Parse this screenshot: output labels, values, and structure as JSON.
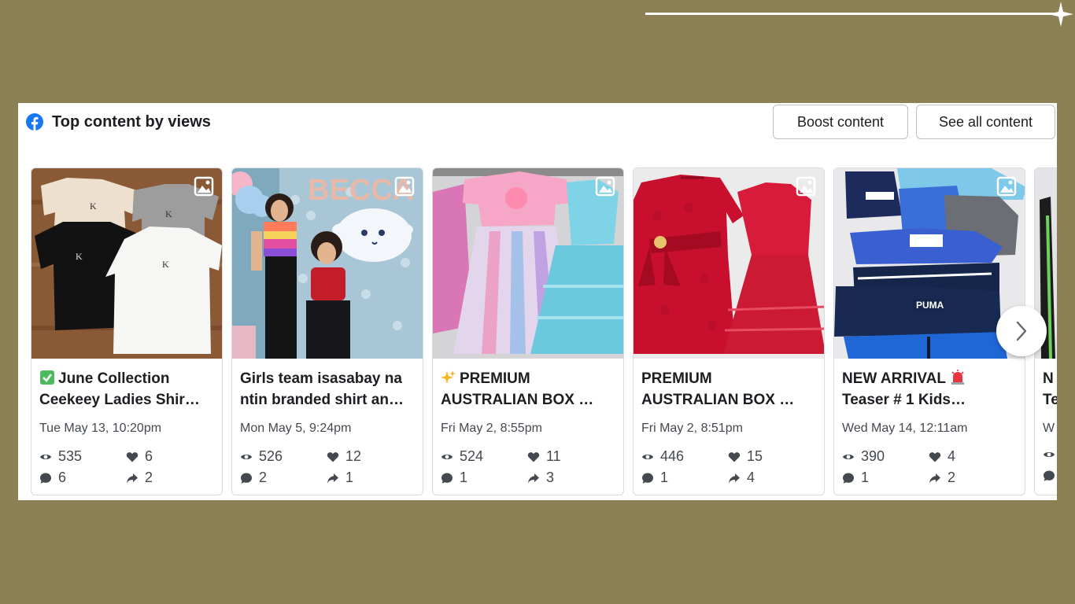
{
  "header": {
    "title": "Top content by views",
    "boost_label": "Boost content",
    "see_all_label": "See all content",
    "icon": "facebook-logo-icon"
  },
  "cards": [
    {
      "title_line1": "June Collection",
      "title_line2": "Ceekeey Ladies Shir…",
      "prefix_icon": "check-mark-emoji-icon",
      "date": "Tue May 13, 10:20pm",
      "views": "535",
      "reactions": "6",
      "comments": "6",
      "shares": "2",
      "image": "white, black and grey t-shirts on wood floor"
    },
    {
      "title_line1": "Girls team isasabay na",
      "title_line2": "ntin branded shirt an…",
      "date": "Mon May 5, 9:24pm",
      "views": "526",
      "reactions": "12",
      "comments": "2",
      "shares": "1",
      "image": "two girls posing at party backdrop"
    },
    {
      "title_line1": "PREMIUM",
      "title_line2": "AUSTRALIAN BOX …",
      "prefix_icon": "sparkles-emoji-icon",
      "date": "Fri May 2, 8:55pm",
      "views": "524",
      "reactions": "11",
      "comments": "1",
      "shares": "3",
      "image": "pink and aqua tulle dresses"
    },
    {
      "title_line1": "PREMIUM",
      "title_line2": "AUSTRALIAN BOX …",
      "date": "Fri May 2, 8:51pm",
      "views": "446",
      "reactions": "15",
      "comments": "1",
      "shares": "4",
      "image": "two red lace dresses"
    },
    {
      "title_line1": "NEW ARRIVAL",
      "title_line2": "Teaser # 1 Kids…",
      "suffix_icon": "siren-emoji-icon",
      "date": "Wed May 14, 12:11am",
      "views": "390",
      "reactions": "4",
      "comments": "1",
      "shares": "2",
      "image": "kids jackets and hoodies laid out"
    },
    {
      "title_line1": "N",
      "title_line2": "Te",
      "date": "W"
    }
  ],
  "navigation": {
    "next_icon": "chevron-right-icon"
  },
  "colors": {
    "accent": "#1877f2",
    "background": "#8e8055"
  }
}
